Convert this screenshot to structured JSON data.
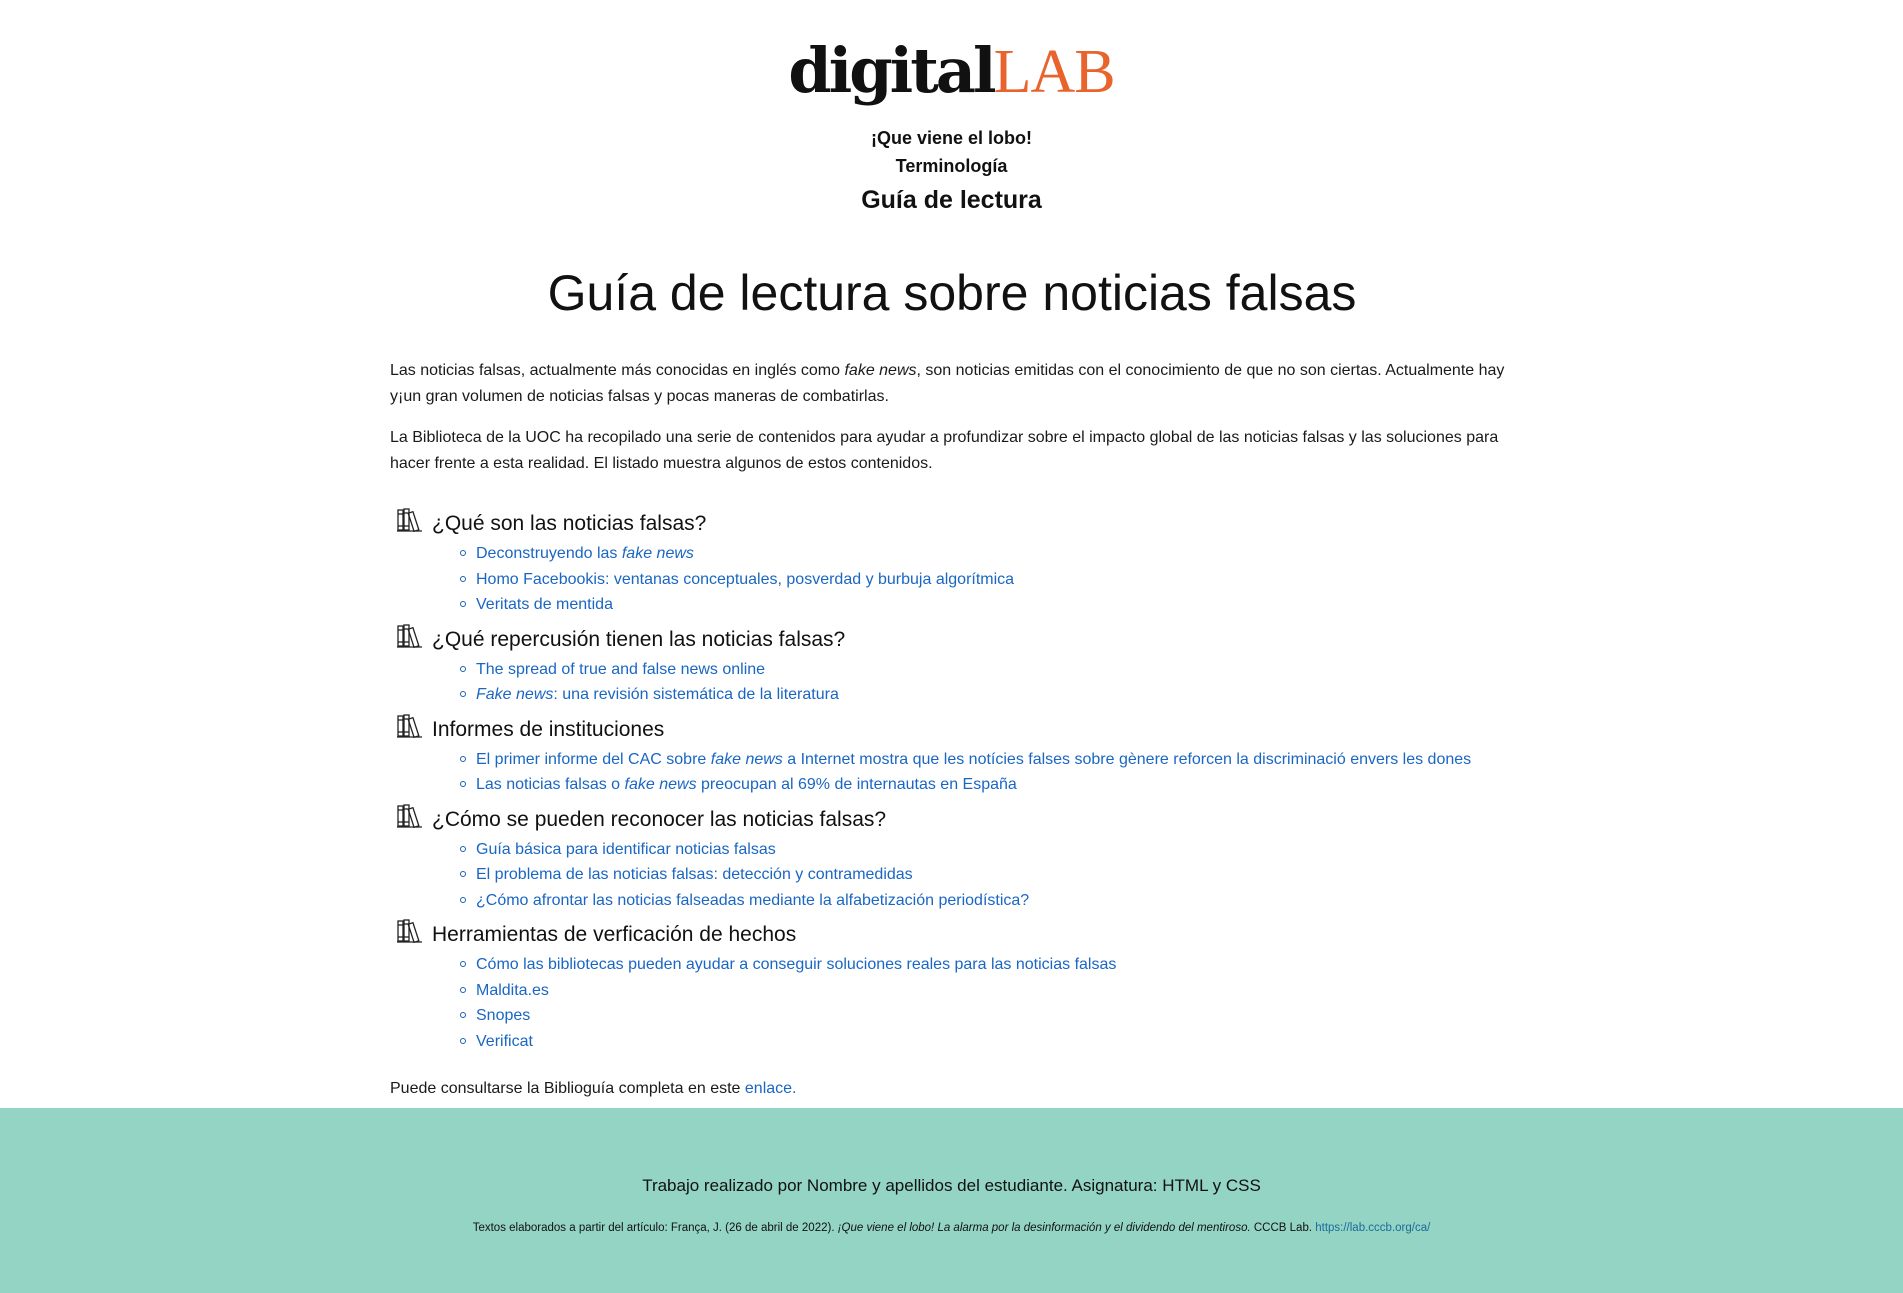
{
  "logo": {
    "part1": "digital",
    "part2": "LAB"
  },
  "nav": [
    {
      "label": "¡Que viene el lobo!"
    },
    {
      "label": "Terminología"
    },
    {
      "label": "Guía de lectura",
      "current": true
    }
  ],
  "main": {
    "title": "Guía de lectura sobre noticias falsas",
    "intro1": {
      "before": "Las noticias falsas, actualmente más conocidas en inglés como ",
      "em": "fake news",
      "after": ", son noticias emitidas con el conocimiento de que no son ciertas. Actualmente hay y¡un gran volumen de noticias falsas y pocas maneras de combatirlas."
    },
    "intro2": "La Biblioteca de la UOC ha recopilado una serie de contenidos para ayudar a profundizar sobre el impacto global de las noticias falsas y las soluciones para hacer frente a esta realidad. El listado muestra algunos de estos contenidos.",
    "sections": [
      {
        "icon": "books-icon",
        "title": "¿Qué son las noticias falsas?",
        "links": [
          {
            "before": "Deconstruyendo las ",
            "em": "fake news",
            "after": ""
          },
          {
            "before": "Homo Facebookis: ventanas conceptuales, posverdad y burbuja algorítmica",
            "em": "",
            "after": ""
          },
          {
            "before": "Veritats de mentida",
            "em": "",
            "after": ""
          }
        ]
      },
      {
        "icon": "books-icon",
        "title": "¿Qué repercusión tienen las noticias falsas?",
        "links": [
          {
            "before": "The spread of true and false news online",
            "em": "",
            "after": ""
          },
          {
            "before": "",
            "em": "Fake news",
            "after": ": una revisión sistemática de la literatura"
          }
        ]
      },
      {
        "icon": "books-icon",
        "title": "Informes de instituciones",
        "links": [
          {
            "before": "El primer informe del CAC sobre ",
            "em": "fake news",
            "after": " a Internet mostra que les notícies falses sobre gènere reforcen la discriminació envers les dones"
          },
          {
            "before": "Las noticias falsas o ",
            "em": "fake news",
            "after": " preocupan al 69% de internautas en España"
          }
        ]
      },
      {
        "icon": "books-icon",
        "title": "¿Cómo se pueden reconocer las noticias falsas?",
        "links": [
          {
            "before": "Guía básica para identificar noticias falsas",
            "em": "",
            "after": ""
          },
          {
            "before": "El problema de las noticias falsas: detección y contramedidas",
            "em": "",
            "after": ""
          },
          {
            "before": "¿Cómo afrontar las noticias falseadas mediante la alfabetización periodística?",
            "em": "",
            "after": ""
          }
        ]
      },
      {
        "icon": "books-icon",
        "title": "Herramientas de verficación de hechos",
        "links": [
          {
            "before": "Cómo las bibliotecas pueden ayudar a conseguir soluciones reales para las noticias falsas",
            "em": "",
            "after": ""
          },
          {
            "before": "Maldita.es",
            "em": "",
            "after": ""
          },
          {
            "before": "Snopes",
            "em": "",
            "after": ""
          },
          {
            "before": "Verificat",
            "em": "",
            "after": ""
          }
        ]
      }
    ],
    "closing": {
      "text": "Puede consultarse la Biblioguía completa en este ",
      "link": "enlace."
    }
  },
  "footer": {
    "credit": "Trabajo realizado por Nombre y apellidos del estudiante. Asignatura: HTML y CSS",
    "source_before": "Textos elaborados a partir del artículo: França, J. (26 de abril de 2022). ",
    "source_em": "¡Que viene el lobo! La alarma por la desinformación y el dividendo del mentiroso.",
    "source_after": " CCCB Lab. ",
    "source_link": "https://lab.cccb.org/ca/"
  },
  "colors": {
    "accent": "#e8642c",
    "link": "#1a66c4",
    "footer_bg": "#93d4c4"
  }
}
